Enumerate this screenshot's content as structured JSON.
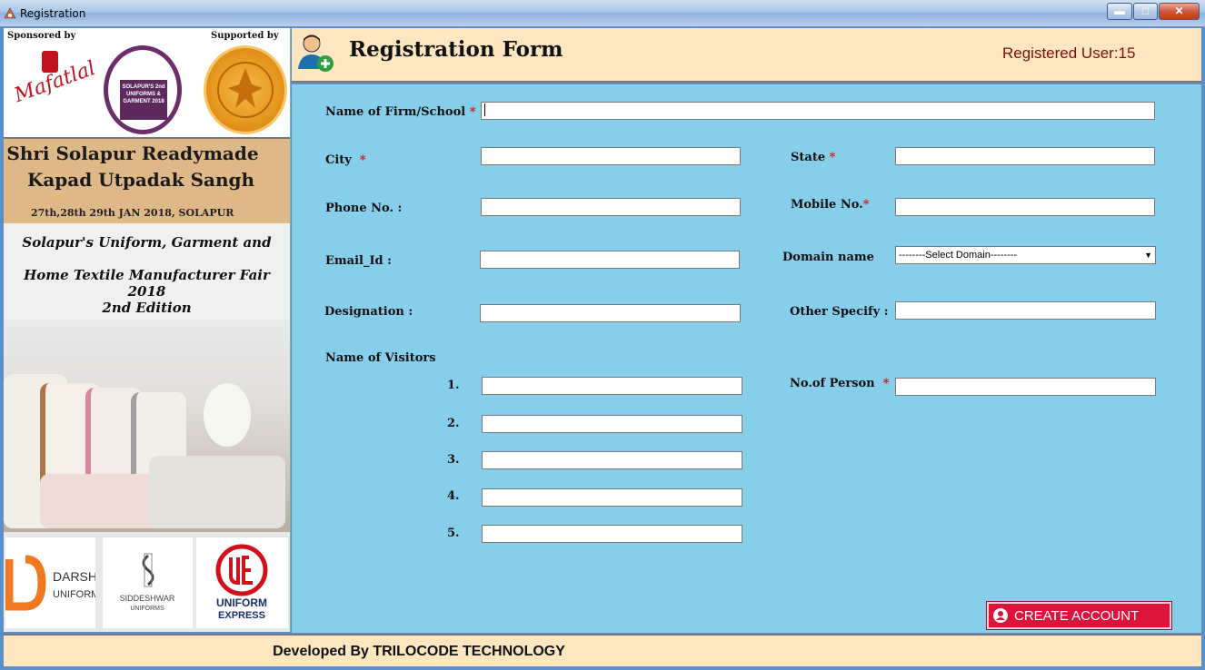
{
  "window": {
    "title": "Registration"
  },
  "sidebar": {
    "sponsored_label": "Sponsored by",
    "supported_label": "Supported by",
    "sponsor_logo_text": "Mafatlal",
    "badge_text": "SOLAPUR'S 2nd UNIFORMS & GARMENT 2018",
    "org_name_line1": "Shri Solapur Readymade",
    "org_name_line2": "Kapad Utpadak Sangh",
    "dates": "27th,28th  29th JAN 2018, SOLAPUR",
    "fair_line1": "Solapur's Uniform, Garment and",
    "fair_line2": "Home Textile Manufacturer Fair 2018",
    "fair_line3": "2nd Edition",
    "logos": [
      {
        "name": "DARSHAN",
        "sub": "UNIFORMS"
      },
      {
        "name": "SIDDESHWAR",
        "sub": "UNIFORMS"
      },
      {
        "name": "UNIFORM",
        "sub": "EXPRESS"
      }
    ]
  },
  "header": {
    "title": "Registration Form",
    "registered_user": "Registered User:15"
  },
  "form": {
    "firm_label": "Name of Firm/School",
    "city_label": "City",
    "state_label": "State",
    "phone_label": "Phone No. :",
    "mobile_label": "Mobile No.",
    "email_label": "Email_Id :",
    "domain_label": "Domain name",
    "domain_selected": "--------Select Domain--------",
    "designation_label": "Designation :",
    "other_label": "Other Specify :",
    "visitors_label": "Name of Visitors",
    "visitor_nums": [
      "1.",
      "2.",
      "3.",
      "4.",
      "5."
    ],
    "persons_label": "No.of Person",
    "required_mark": "*",
    "create_button": "CREATE ACCOUNT"
  },
  "footer": {
    "text": "Developed By TRILOCODE TECHNOLOGY"
  },
  "colors": {
    "form_bg": "#87ceeb",
    "header_bg": "#fde6c0",
    "button_bg": "#dc143c",
    "required": "#e01010",
    "user_count": "#7a0f0f"
  }
}
